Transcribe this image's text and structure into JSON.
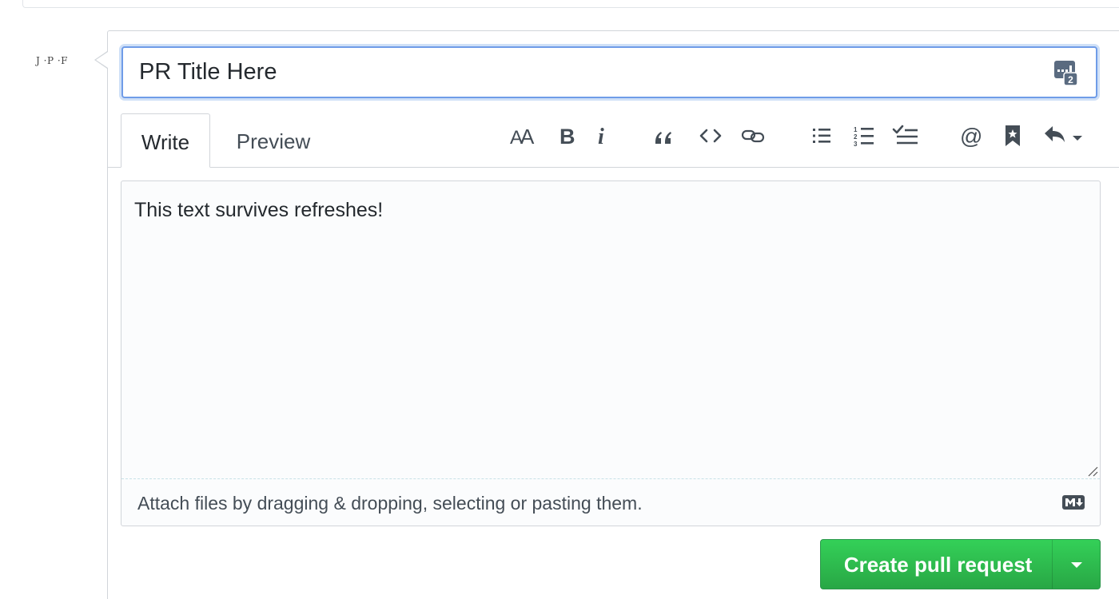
{
  "avatar": {
    "initials": "J ·P ·F"
  },
  "title_input": {
    "value": "PR Title Here"
  },
  "tabs": [
    {
      "label": "Write",
      "active": true
    },
    {
      "label": "Preview",
      "active": false
    }
  ],
  "toolbar": {
    "buttons": [
      {
        "icon": "text-size-icon",
        "glyph": "AA"
      },
      {
        "icon": "bold-icon",
        "glyph": "B"
      },
      {
        "icon": "italic-icon",
        "glyph": "i"
      },
      {
        "icon": "quote-icon"
      },
      {
        "icon": "code-icon"
      },
      {
        "icon": "link-icon"
      },
      {
        "icon": "bulleted-list-icon"
      },
      {
        "icon": "numbered-list-icon"
      },
      {
        "icon": "task-list-icon"
      },
      {
        "icon": "mention-icon",
        "glyph": "@"
      },
      {
        "icon": "saved-reply-icon"
      },
      {
        "icon": "reply-dropdown-icon"
      }
    ]
  },
  "body_textarea": {
    "value": "This text survives refreshes!"
  },
  "attach": {
    "text": "Attach files by dragging & dropping, selecting or pasting them."
  },
  "create_button": {
    "label": "Create pull request"
  },
  "colors": {
    "accent_blue": "#6f9ce8",
    "button_green": "#28a745",
    "text": "#24292e",
    "icon": "#444d56"
  }
}
